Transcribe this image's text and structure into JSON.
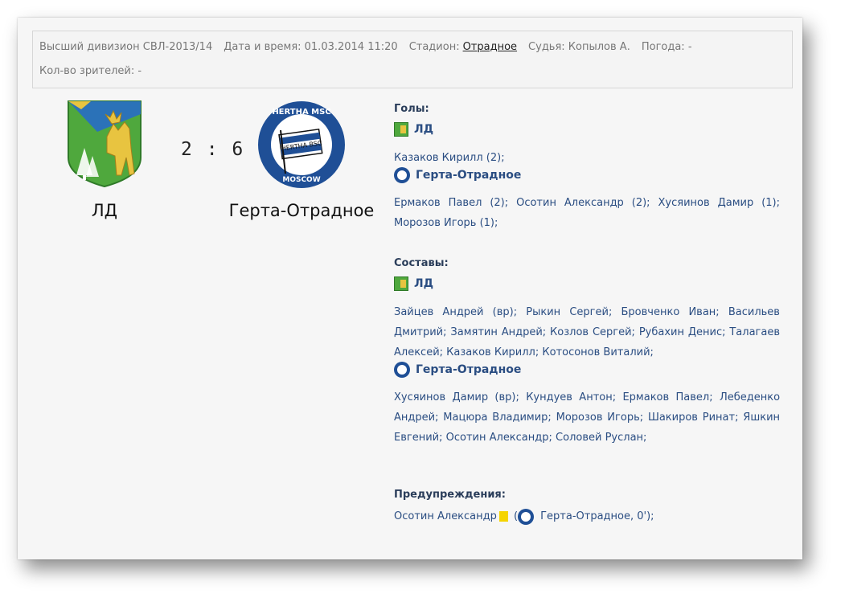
{
  "info": {
    "division": "Высший дивизион СВЛ-2013/14",
    "datetime_label": "Дата и время: 01.03.2014 11:20",
    "stadium_label": "Стадион:",
    "stadium_value": "Отрадное",
    "referee": "Судья: Копылов А.",
    "weather": "Погода: -",
    "spectators": "Кол-во зрителей: -"
  },
  "match": {
    "home": {
      "name": "ЛД",
      "logo_icon": "moose-crest-icon"
    },
    "away": {
      "name": "Герта-Отрадное",
      "logo_icon": "hertha-msc-moscow-icon",
      "logo_top_text": "HERTHA MSC",
      "logo_bottom_text": "MOSCOW",
      "logo_flag_text": "HERTHA BSC"
    },
    "score": "2 : 6"
  },
  "goals": {
    "title": "Голы:",
    "home_team": "ЛД",
    "home_scorers": [
      "Казаков Кирилл (2);"
    ],
    "away_team": "Герта-Отрадное",
    "away_scorers": [
      "Ермаков Павел (2);",
      "Осотин Александр (2);",
      "Хусяинов Дамир (1);",
      "Морозов Игорь (1);"
    ]
  },
  "lineups": {
    "title": "Составы:",
    "home_team": "ЛД",
    "home_players": [
      "Зайцев Андрей (вр);",
      "Рыкин Сергей;",
      "Бровченко Иван;",
      "Васильев Дмитрий;",
      "Замятин Андрей;",
      "Козлов Сергей;",
      "Рубахин Денис;",
      "Талагаев Алексей;",
      "Казаков Кирилл;",
      "Котосонов Виталий;"
    ],
    "away_team": "Герта-Отрадное",
    "away_players": [
      "Хусяинов Дамир (вр);",
      "Кундуев Антон;",
      "Ермаков Павел;",
      "Лебеденко Андрей;",
      "Мацюра Владимир;",
      "Морозов Игорь;",
      "Шакиров Ринат;",
      "Яшкин Евгений;",
      "Осотин Александр;",
      "Соловей Руслан;"
    ]
  },
  "warnings": {
    "title": "Предупреждения:",
    "player": "Осотин Александр",
    "card_color": "#f5d400",
    "open": "(",
    "team_minute": "Герта-Отрадное, 0');"
  },
  "colors": {
    "link": "#2a4d82",
    "hertha_blue": "#1f4f96",
    "ld_green": "#4fa83d"
  }
}
